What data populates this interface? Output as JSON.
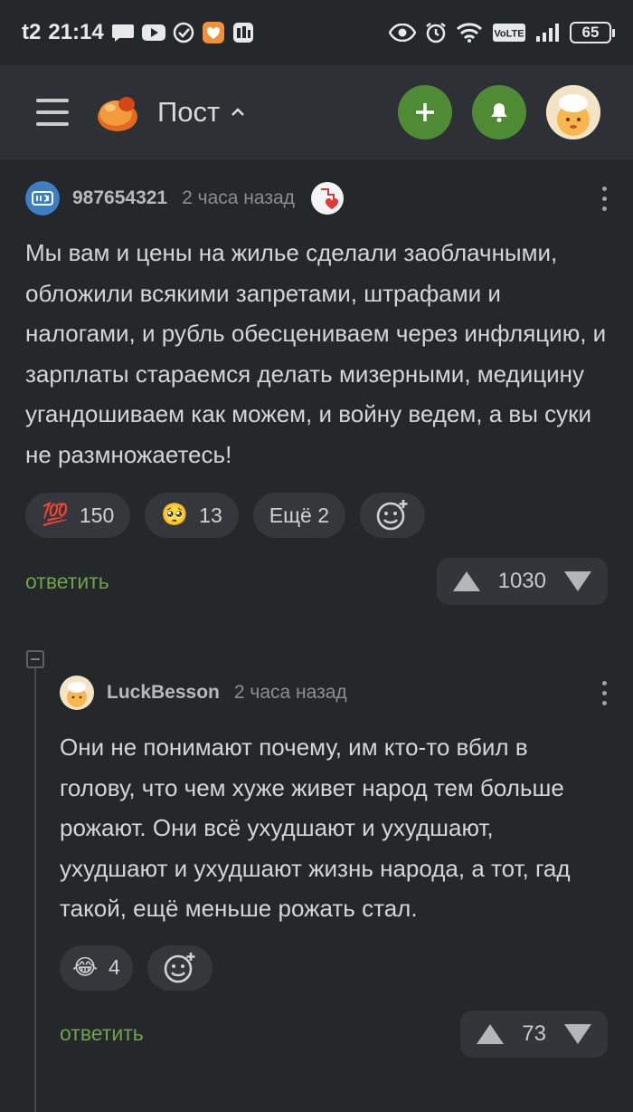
{
  "status_bar": {
    "carrier": "t2",
    "time": "21:14",
    "network_label": "VoLTE",
    "battery": "65"
  },
  "header": {
    "title": "Пост",
    "icons": [
      "menu-icon",
      "pikabu-logo",
      "chevron-up-icon",
      "plus-icon",
      "bell-icon",
      "avatar"
    ]
  },
  "comments": [
    {
      "user": "987654321",
      "time": "2 часа назад",
      "text": "Мы вам и цены на жилье сделали заоблачными, обложили всякими запретами, штрафами и налогами, и рубль обесцениваем через инфляцию, и зарплаты стараемся делать мизерными, медицину угандошиваем как можем, и войну ведем, а вы суки не размножаетесь!",
      "reactions": [
        {
          "emoji": "💯",
          "count": "150"
        },
        {
          "emoji": "🥺",
          "count": "13"
        }
      ],
      "more_label": "Ещё 2",
      "reply_label": "ответить",
      "rating": "1030"
    },
    {
      "user": "LuckBesson",
      "time": "2 часа назад",
      "text": "Они не понимают почему, им кто-то вбил в голову, что чем хуже живет народ тем больше рожают. Они всё ухудшают и ухудшают, ухудшают и ухудшают жизнь народа, а тот, гад такой, ещё меньше рожать стал.",
      "reactions": [
        {
          "emoji": "😂",
          "count": "4"
        }
      ],
      "reply_label": "ответить",
      "rating": "73"
    }
  ],
  "colors": {
    "background": "#25282b",
    "topbar": "#2d3034",
    "accent_green": "#4f8b34",
    "reply_green": "#6fa24a"
  }
}
